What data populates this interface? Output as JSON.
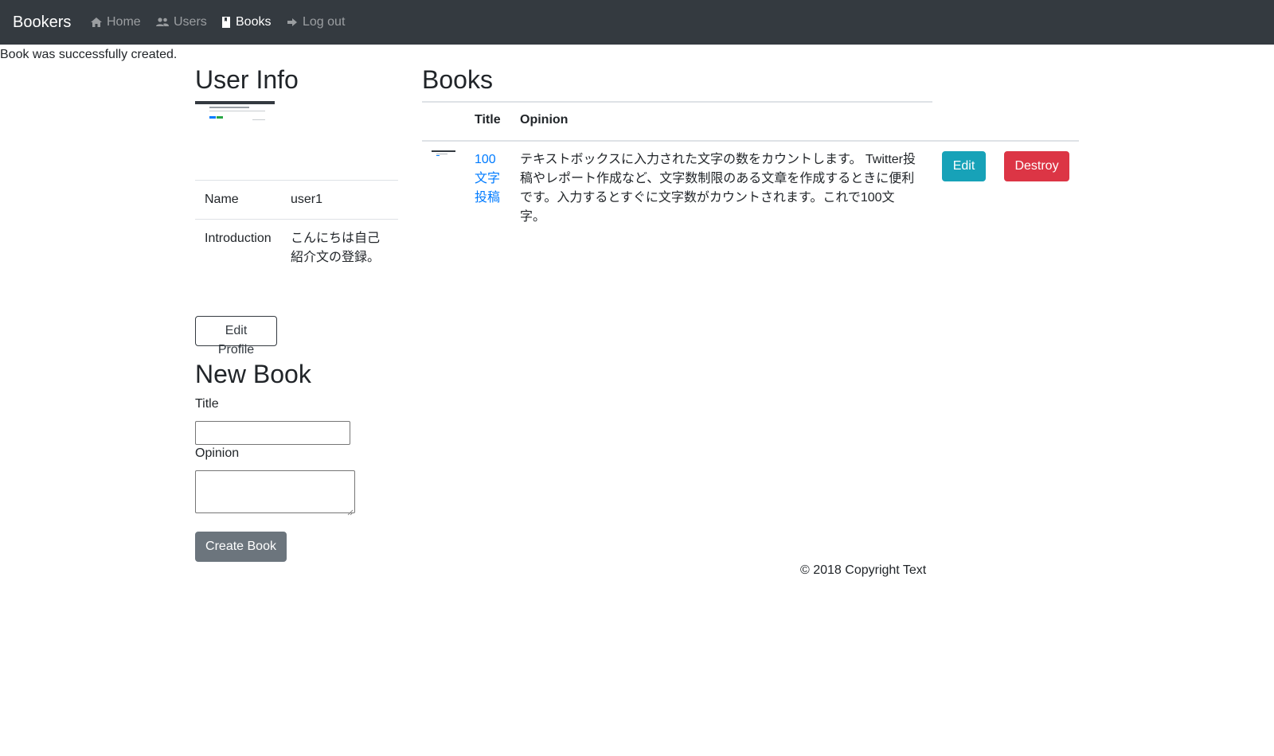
{
  "navbar": {
    "brand": "Bookers",
    "items": [
      {
        "label": "Home",
        "icon": "home-icon"
      },
      {
        "label": "Users",
        "icon": "users-icon"
      },
      {
        "label": "Books",
        "icon": "book-icon"
      },
      {
        "label": "Log out",
        "icon": "logout-icon"
      }
    ]
  },
  "flash": "Book was successfully created.",
  "user_info": {
    "heading": "User Info",
    "rows": [
      {
        "label": "Name",
        "value": "user1"
      },
      {
        "label": "Introduction",
        "value": "こんにちは自己紹介文の登録。"
      }
    ],
    "edit_button": "Edit Profile"
  },
  "new_book": {
    "heading": "New Book",
    "title_label": "Title",
    "title_value": "",
    "opinion_label": "Opinion",
    "opinion_value": "",
    "submit": "Create Book"
  },
  "books": {
    "heading": "Books",
    "columns": [
      "",
      "Title",
      "Opinion",
      "",
      ""
    ],
    "rows": [
      {
        "title": "100文字投稿",
        "opinion": "テキストボックスに入力された文字の数をカウントします。 Twitter投稿やレポート作成など、文字数制限のある文章を作成するときに便利です。入力するとすぐに文字数がカウントされます。これで100文字。",
        "edit": "Edit",
        "destroy": "Destroy"
      }
    ]
  },
  "footer": "© 2018 Copyright Text",
  "colors": {
    "navbar_bg": "#343a40",
    "link": "#007bff",
    "info": "#17a2b8",
    "danger": "#dc3545",
    "secondary": "#6c757d"
  }
}
